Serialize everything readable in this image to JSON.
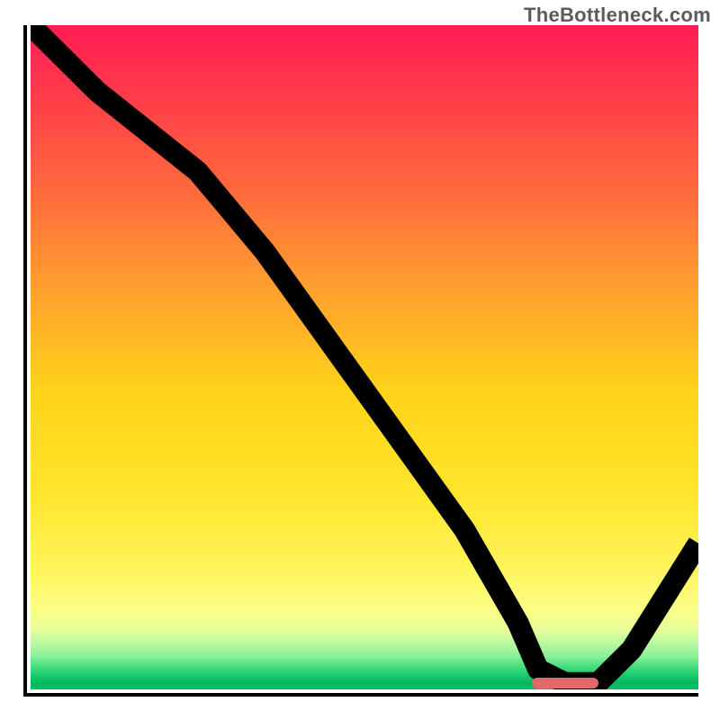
{
  "watermark": "TheBottleneck.com",
  "chart_data": {
    "type": "line",
    "title": "",
    "xlabel": "",
    "ylabel": "",
    "xlim": [
      0,
      100
    ],
    "ylim": [
      0,
      100
    ],
    "grid": false,
    "legend": false,
    "series": [
      {
        "name": "curve",
        "x": [
          0,
          10,
          25,
          35,
          50,
          65,
          73,
          76,
          80,
          85,
          90,
          95,
          100
        ],
        "y": [
          100,
          90,
          78,
          66,
          45,
          24,
          10,
          3,
          1,
          1,
          6,
          14,
          22
        ]
      }
    ],
    "annotations": [
      {
        "name": "optimal-marker",
        "x_start": 75,
        "x_end": 85,
        "y": 1,
        "color": "#e06a6a"
      }
    ],
    "background_gradient": [
      {
        "pos": 0.0,
        "color": "#ff1e55"
      },
      {
        "pos": 0.55,
        "color": "#ffe52a"
      },
      {
        "pos": 0.9,
        "color": "#e8ff99"
      },
      {
        "pos": 1.0,
        "color": "#03c26a"
      }
    ]
  }
}
